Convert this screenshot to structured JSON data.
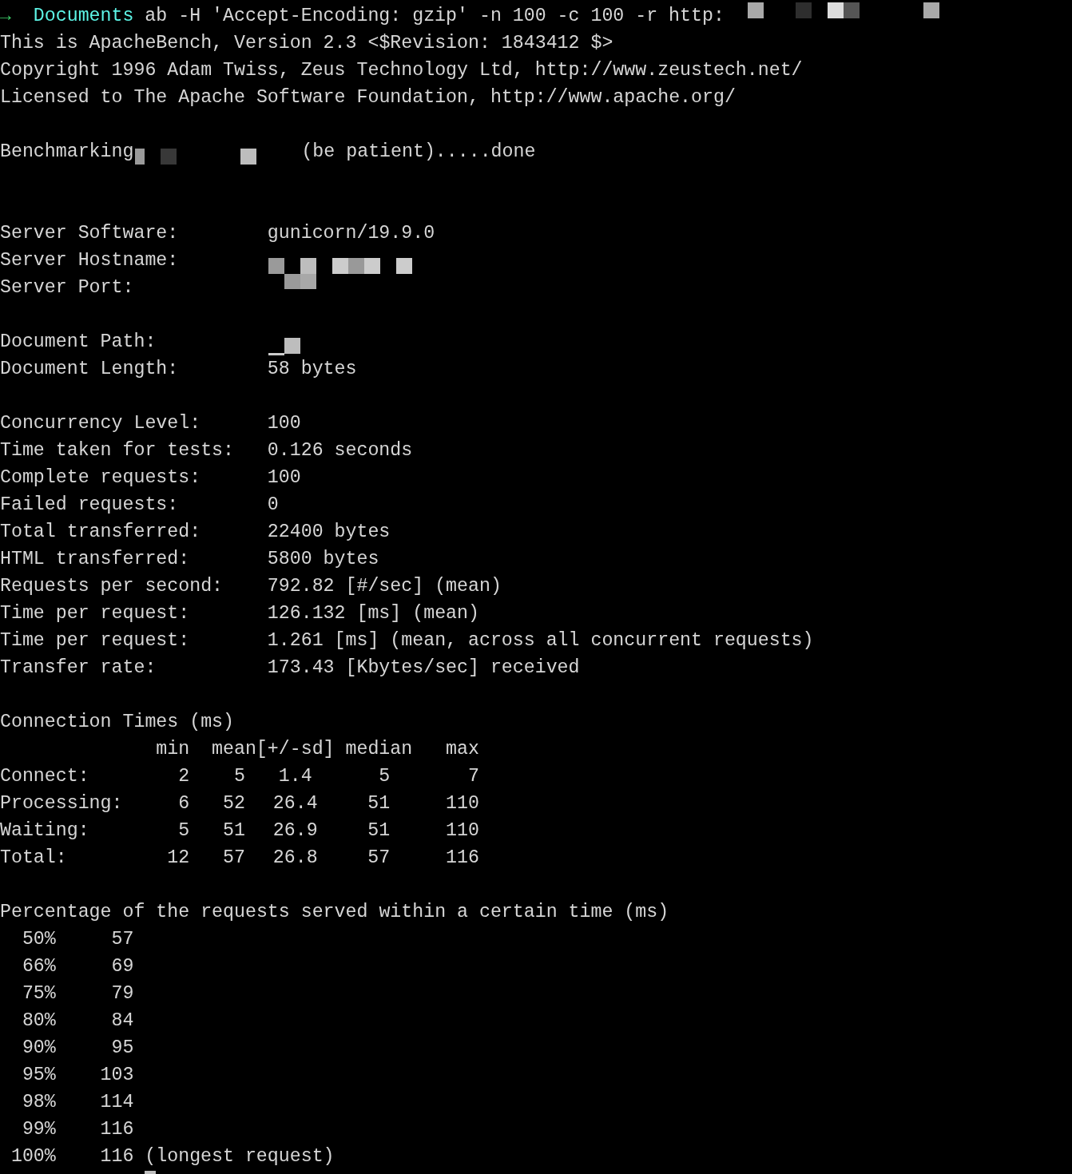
{
  "prompt": {
    "arrow": "→",
    "directory": "Documents",
    "command": "ab -H 'Accept-Encoding: gzip' -n 100 -c 100 -r http:"
  },
  "header_lines": [
    "This is ApacheBench, Version 2.3 <$Revision: 1843412 $>",
    "Copyright 1996 Adam Twiss, Zeus Technology Ltd, http://www.zeustech.net/",
    "Licensed to The Apache Software Foundation, http://www.apache.org/"
  ],
  "benchmarking": {
    "label": "Benchmarking",
    "status": "(be patient).....done"
  },
  "server": [
    {
      "label": "Server Software:",
      "value": "gunicorn/19.9.0"
    },
    {
      "label": "Server Hostname:",
      "redacted": true
    },
    {
      "label": "Server Port:",
      "redacted": true
    }
  ],
  "document": [
    {
      "label": "Document Path:",
      "redacted": true
    },
    {
      "label": "Document Length:",
      "value": "58 bytes"
    }
  ],
  "stats": [
    {
      "label": "Concurrency Level:",
      "value": "100"
    },
    {
      "label": "Time taken for tests:",
      "value": "0.126 seconds"
    },
    {
      "label": "Complete requests:",
      "value": "100"
    },
    {
      "label": "Failed requests:",
      "value": "0"
    },
    {
      "label": "Total transferred:",
      "value": "22400 bytes"
    },
    {
      "label": "HTML transferred:",
      "value": "5800 bytes"
    },
    {
      "label": "Requests per second:",
      "value": "792.82 [#/sec] (mean)"
    },
    {
      "label": "Time per request:",
      "value": "126.132 [ms] (mean)"
    },
    {
      "label": "Time per request:",
      "value": "1.261 [ms] (mean, across all concurrent requests)"
    },
    {
      "label": "Transfer rate:",
      "value": "173.43 [Kbytes/sec] received"
    }
  ],
  "connection_times": {
    "title": "Connection Times (ms)",
    "columns": [
      "min",
      "mean[+/-sd]",
      "",
      "median",
      "max"
    ],
    "rows": [
      {
        "label": "Connect:",
        "cells": [
          "2",
          "5",
          "1.4",
          "5",
          "7"
        ]
      },
      {
        "label": "Processing:",
        "cells": [
          "6",
          "52",
          "26.4",
          "51",
          "110"
        ]
      },
      {
        "label": "Waiting:",
        "cells": [
          "5",
          "51",
          "26.9",
          "51",
          "110"
        ]
      },
      {
        "label": "Total:",
        "cells": [
          "12",
          "57",
          "26.8",
          "57",
          "116"
        ]
      }
    ]
  },
  "percentiles": {
    "title": "Percentage of the requests served within a certain time (ms)",
    "rows": [
      {
        "percent": "50%",
        "time": "57"
      },
      {
        "percent": "66%",
        "time": "69"
      },
      {
        "percent": "75%",
        "time": "79"
      },
      {
        "percent": "80%",
        "time": "84"
      },
      {
        "percent": "90%",
        "time": "95"
      },
      {
        "percent": "95%",
        "time": "103"
      },
      {
        "percent": "98%",
        "time": "114"
      },
      {
        "percent": "99%",
        "time": "116"
      },
      {
        "percent": "100%",
        "time": "116",
        "note": "(longest request)"
      }
    ]
  }
}
